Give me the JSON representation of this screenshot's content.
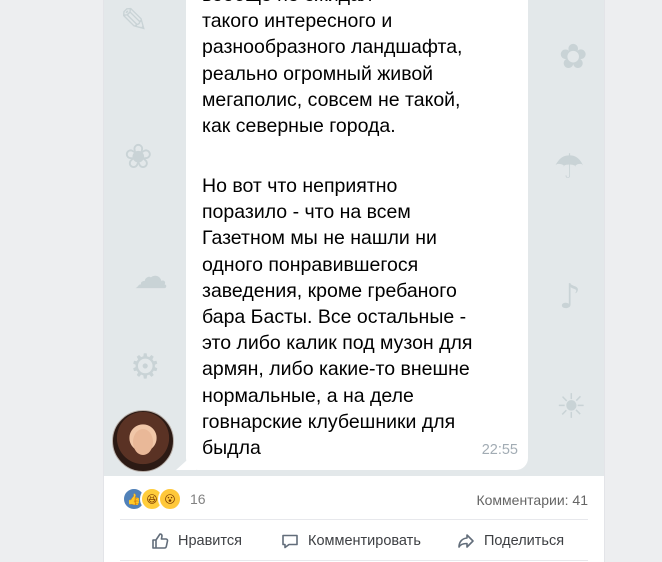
{
  "message": {
    "paragraph1": "вообще не ожидал\nтакого интересного и\nразнообразного ландшафта,\nреально огромный живой\nмегаполис, совсем не такой,\nкак северные города.",
    "paragraph2": "Но вот что неприятно\nпоразило - что на всем\nГазетном мы не нашли ни\nодного понравившегося\nзаведения, кроме гребаного\nбара Басты. Все остальные -\nэто либо калик под музон для\nармян, либо какие-то внешне\nнормальные, а на деле\nговнарские клубешники для\nбыдла",
    "time": "22:55"
  },
  "reactions": {
    "icons": [
      "like-reaction",
      "haha-reaction",
      "wow-reaction"
    ],
    "count": "16"
  },
  "comments": {
    "label": "Комментарии: 41"
  },
  "actions": {
    "like": "Нравится",
    "comment": "Комментировать",
    "share": "Поделиться"
  },
  "colors": {
    "accent": "#5181b8",
    "chat_bg": "#e3e8ea"
  }
}
